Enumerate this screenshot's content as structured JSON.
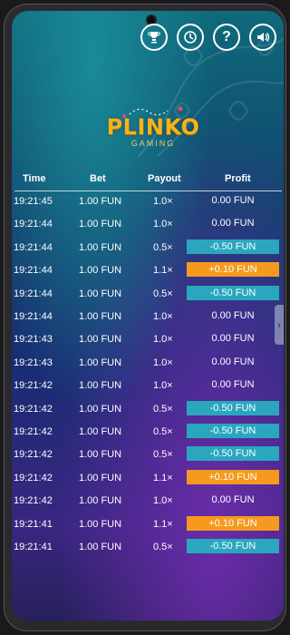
{
  "header": {
    "icons": [
      {
        "name": "trophy-icon",
        "glyph": "🏆"
      },
      {
        "name": "history-icon",
        "glyph": "⏱"
      },
      {
        "name": "help-icon",
        "glyph": "?"
      },
      {
        "name": "sound-icon",
        "glyph": "🔊"
      }
    ]
  },
  "logo": {
    "title": "PLINKO",
    "subtitle": "GAMING"
  },
  "table": {
    "headers": {
      "time": "Time",
      "bet": "Bet",
      "payout": "Payout",
      "profit": "Profit"
    },
    "rows": [
      {
        "time": "19:21:45",
        "bet": "1.00 FUN",
        "payout": "1.0×",
        "profit": "0.00 FUN",
        "state": "neutral"
      },
      {
        "time": "19:21:44",
        "bet": "1.00 FUN",
        "payout": "1.0×",
        "profit": "0.00 FUN",
        "state": "neutral"
      },
      {
        "time": "19:21:44",
        "bet": "1.00 FUN",
        "payout": "0.5×",
        "profit": "-0.50 FUN",
        "state": "loss"
      },
      {
        "time": "19:21:44",
        "bet": "1.00 FUN",
        "payout": "1.1×",
        "profit": "+0.10 FUN",
        "state": "win"
      },
      {
        "time": "19:21:44",
        "bet": "1.00 FUN",
        "payout": "0.5×",
        "profit": "-0.50 FUN",
        "state": "loss"
      },
      {
        "time": "19:21:44",
        "bet": "1.00 FUN",
        "payout": "1.0×",
        "profit": "0.00 FUN",
        "state": "neutral"
      },
      {
        "time": "19:21:43",
        "bet": "1.00 FUN",
        "payout": "1.0×",
        "profit": "0.00 FUN",
        "state": "neutral"
      },
      {
        "time": "19:21:43",
        "bet": "1.00 FUN",
        "payout": "1.0×",
        "profit": "0.00 FUN",
        "state": "neutral"
      },
      {
        "time": "19:21:42",
        "bet": "1.00 FUN",
        "payout": "1.0×",
        "profit": "0.00 FUN",
        "state": "neutral"
      },
      {
        "time": "19:21:42",
        "bet": "1.00 FUN",
        "payout": "0.5×",
        "profit": "-0.50 FUN",
        "state": "loss"
      },
      {
        "time": "19:21:42",
        "bet": "1.00 FUN",
        "payout": "0.5×",
        "profit": "-0.50 FUN",
        "state": "loss"
      },
      {
        "time": "19:21:42",
        "bet": "1.00 FUN",
        "payout": "0.5×",
        "profit": "-0.50 FUN",
        "state": "loss"
      },
      {
        "time": "19:21:42",
        "bet": "1.00 FUN",
        "payout": "1.1×",
        "profit": "+0.10 FUN",
        "state": "win"
      },
      {
        "time": "19:21:42",
        "bet": "1.00 FUN",
        "payout": "1.0×",
        "profit": "0.00 FUN",
        "state": "neutral"
      },
      {
        "time": "19:21:41",
        "bet": "1.00 FUN",
        "payout": "1.1×",
        "profit": "+0.10 FUN",
        "state": "win"
      },
      {
        "time": "19:21:41",
        "bet": "1.00 FUN",
        "payout": "0.5×",
        "profit": "-0.50 FUN",
        "state": "loss"
      }
    ]
  },
  "side_handle": {
    "glyph": "›"
  },
  "colors": {
    "loss": "#2aa7bf",
    "win": "#f59a1e",
    "logo": "#f5b21c"
  }
}
